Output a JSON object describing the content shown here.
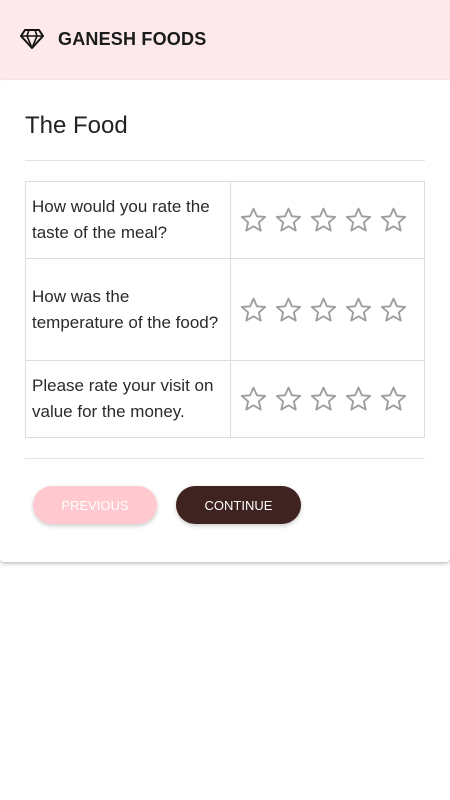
{
  "app": {
    "brand": "GANESH FOODS",
    "logo_icon": "diamond-icon",
    "header_bg": "#fde9ec"
  },
  "section": {
    "title": "The Food"
  },
  "questions": [
    {
      "text": "How would you rate the taste of the meal?",
      "rating": 0,
      "max": 5
    },
    {
      "text": "How was the temperature of the food?",
      "rating": 0,
      "max": 5
    },
    {
      "text": "Please rate your visit on value for the money.",
      "rating": 0,
      "max": 5
    }
  ],
  "buttons": {
    "previous_label": "PREVIOUS",
    "continue_label": "CONTINUE",
    "previous_color": "#ffc9cf",
    "continue_color": "#3e2321"
  },
  "star_icon": "star-outline-icon",
  "star_color": "#9e9e9e"
}
